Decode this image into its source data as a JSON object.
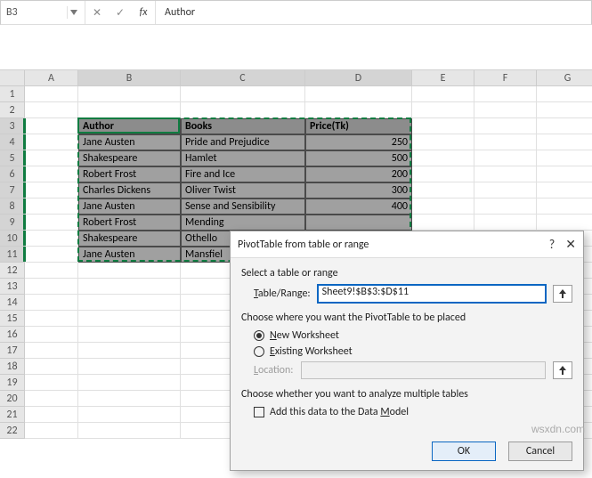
{
  "formula_bar": {
    "name_box_value": "B3",
    "cancel_glyph": "✕",
    "confirm_glyph": "✓",
    "fx_label": "fx",
    "formula_value": "Author"
  },
  "grid": {
    "columns": [
      "A",
      "B",
      "C",
      "D",
      "E",
      "F",
      "G"
    ],
    "row_count": 22,
    "active_cell": "B3",
    "selection": "B3:D11"
  },
  "table": {
    "headers": [
      "Author",
      "Books",
      "Price(Tk)"
    ],
    "rows": [
      [
        "Jane Austen",
        "Pride and Prejudice",
        "250"
      ],
      [
        "Shakespeare",
        "Hamlet",
        "500"
      ],
      [
        "Robert Frost",
        "Fire and Ice",
        "200"
      ],
      [
        "Charles Dickens",
        "Oliver Twist",
        "300"
      ],
      [
        "Jane Austen",
        "Sense and Sensibility",
        "400"
      ],
      [
        "Robert Frost",
        "Mending",
        ""
      ],
      [
        "Shakespeare",
        "Othello",
        ""
      ],
      [
        "Jane Austen",
        "Mansfiel",
        ""
      ]
    ]
  },
  "dialog": {
    "title": "PivotTable from table or range",
    "section_select": "Select a table or range",
    "table_range_label": "Table/Range:",
    "table_range_value": "Sheet9!$B$3:$D$11",
    "where_label": "Choose where you want the PivotTable to be placed",
    "new_worksheet_label": "New Worksheet",
    "existing_worksheet_label": "Existing Worksheet",
    "location_label": "Location:",
    "location_value": "",
    "multi_label": "Choose whether you want to analyze multiple tables",
    "datamodel_label": "Add this data to the Data Model",
    "ok_label": "OK",
    "cancel_label": "Cancel",
    "help_glyph": "?",
    "close_glyph": "✕",
    "collapse_glyph": "⬆"
  },
  "watermark": "wsxdn.com"
}
